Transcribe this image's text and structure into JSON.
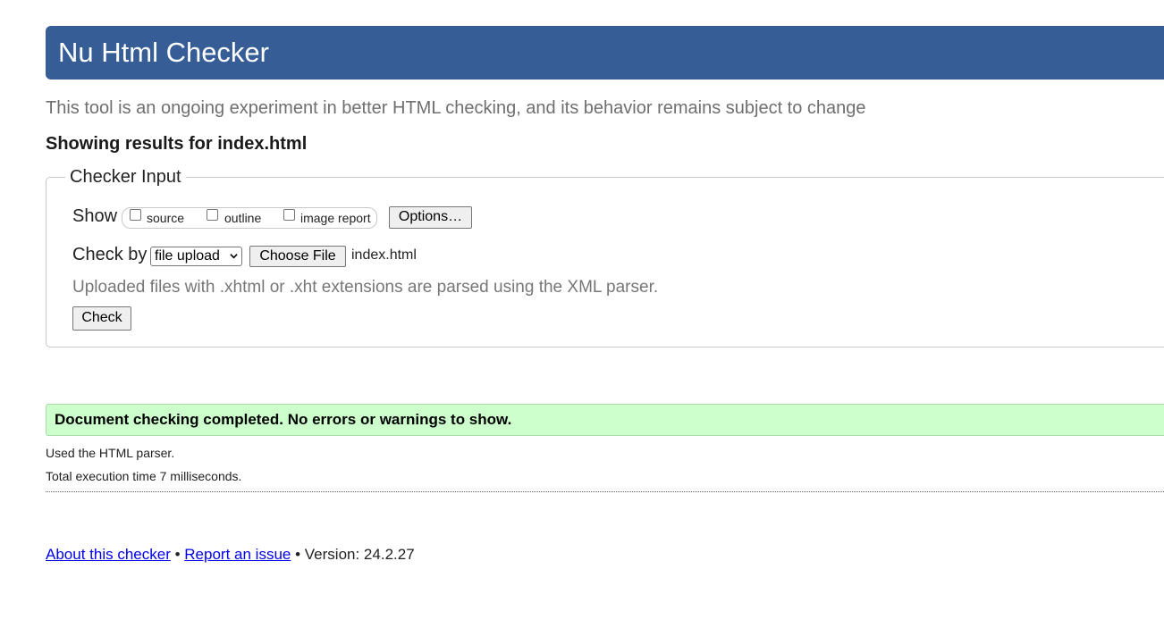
{
  "header": {
    "title": "Nu Html Checker"
  },
  "subtitle": "This tool is an ongoing experiment in better HTML checking, and its behavior remains subject to change",
  "results_for": "Showing results for index.html",
  "checker_input": {
    "legend": "Checker Input",
    "show_label": "Show",
    "show_options": [
      {
        "label": "source",
        "checked": false
      },
      {
        "label": "outline",
        "checked": false
      },
      {
        "label": "image report",
        "checked": false
      }
    ],
    "options_button": "Options…",
    "check_by_label": "Check by",
    "check_by_selected": "file upload",
    "choose_file_button": "Choose File",
    "chosen_file": "index.html",
    "hint": "Uploaded files with .xhtml or .xht extensions are parsed using the XML parser.",
    "check_button": "Check"
  },
  "result": {
    "success_message": "Document checking completed. No errors or warnings to show.",
    "parser_info": "Used the HTML parser.",
    "execution_time": "Total execution time 7 milliseconds."
  },
  "footer": {
    "about_link": "About this checker",
    "separator": "•",
    "report_link": "Report an issue",
    "version": "Version: 24.2.27"
  },
  "colors": {
    "header_bg": "#365d95",
    "success_bg": "#ccffcc",
    "link": "#0000ee"
  }
}
